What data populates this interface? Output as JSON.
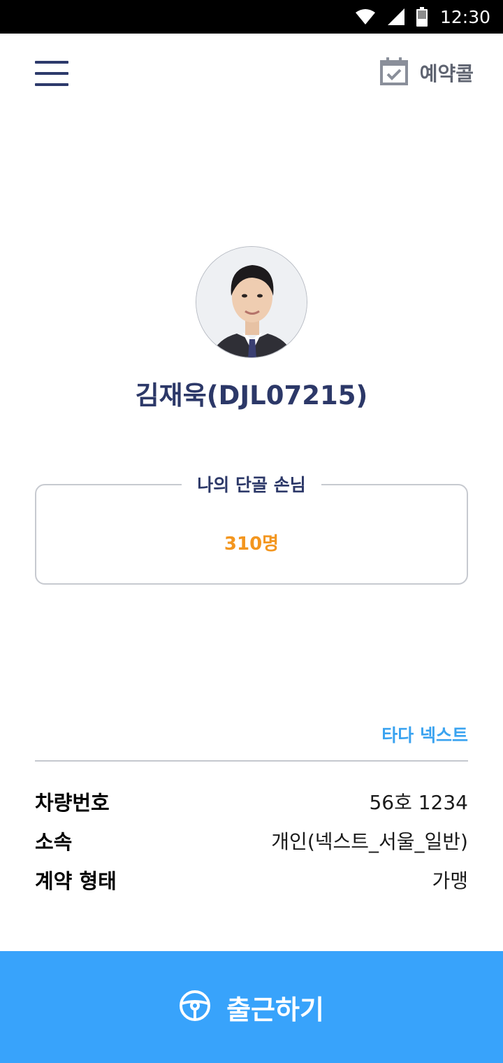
{
  "status_bar": {
    "time": "12:30",
    "icons": [
      "wifi-icon",
      "signal-icon",
      "battery-icon"
    ]
  },
  "header": {
    "menu_icon": "hamburger-menu-icon",
    "reserve_icon": "calendar-check-icon",
    "reserve_label": "예약콜"
  },
  "profile": {
    "name": "김재욱(DJL07215)"
  },
  "regular_customers": {
    "title": "나의 단골 손님",
    "count": "310명"
  },
  "service": {
    "tag": "타다 넥스트"
  },
  "info": [
    {
      "label": "차량번호",
      "value": "56호 1234"
    },
    {
      "label": "소속",
      "value": "개인(넥스트_서울_일반)"
    },
    {
      "label": "계약 형태",
      "value": "가맹"
    }
  ],
  "footer": {
    "start_icon": "steering-wheel-icon",
    "start_label": "출근하기"
  },
  "colors": {
    "navy": "#2c3868",
    "accent_orange": "#f3961f",
    "accent_blue": "#3aa3f0",
    "button_blue": "#38a3fb"
  }
}
